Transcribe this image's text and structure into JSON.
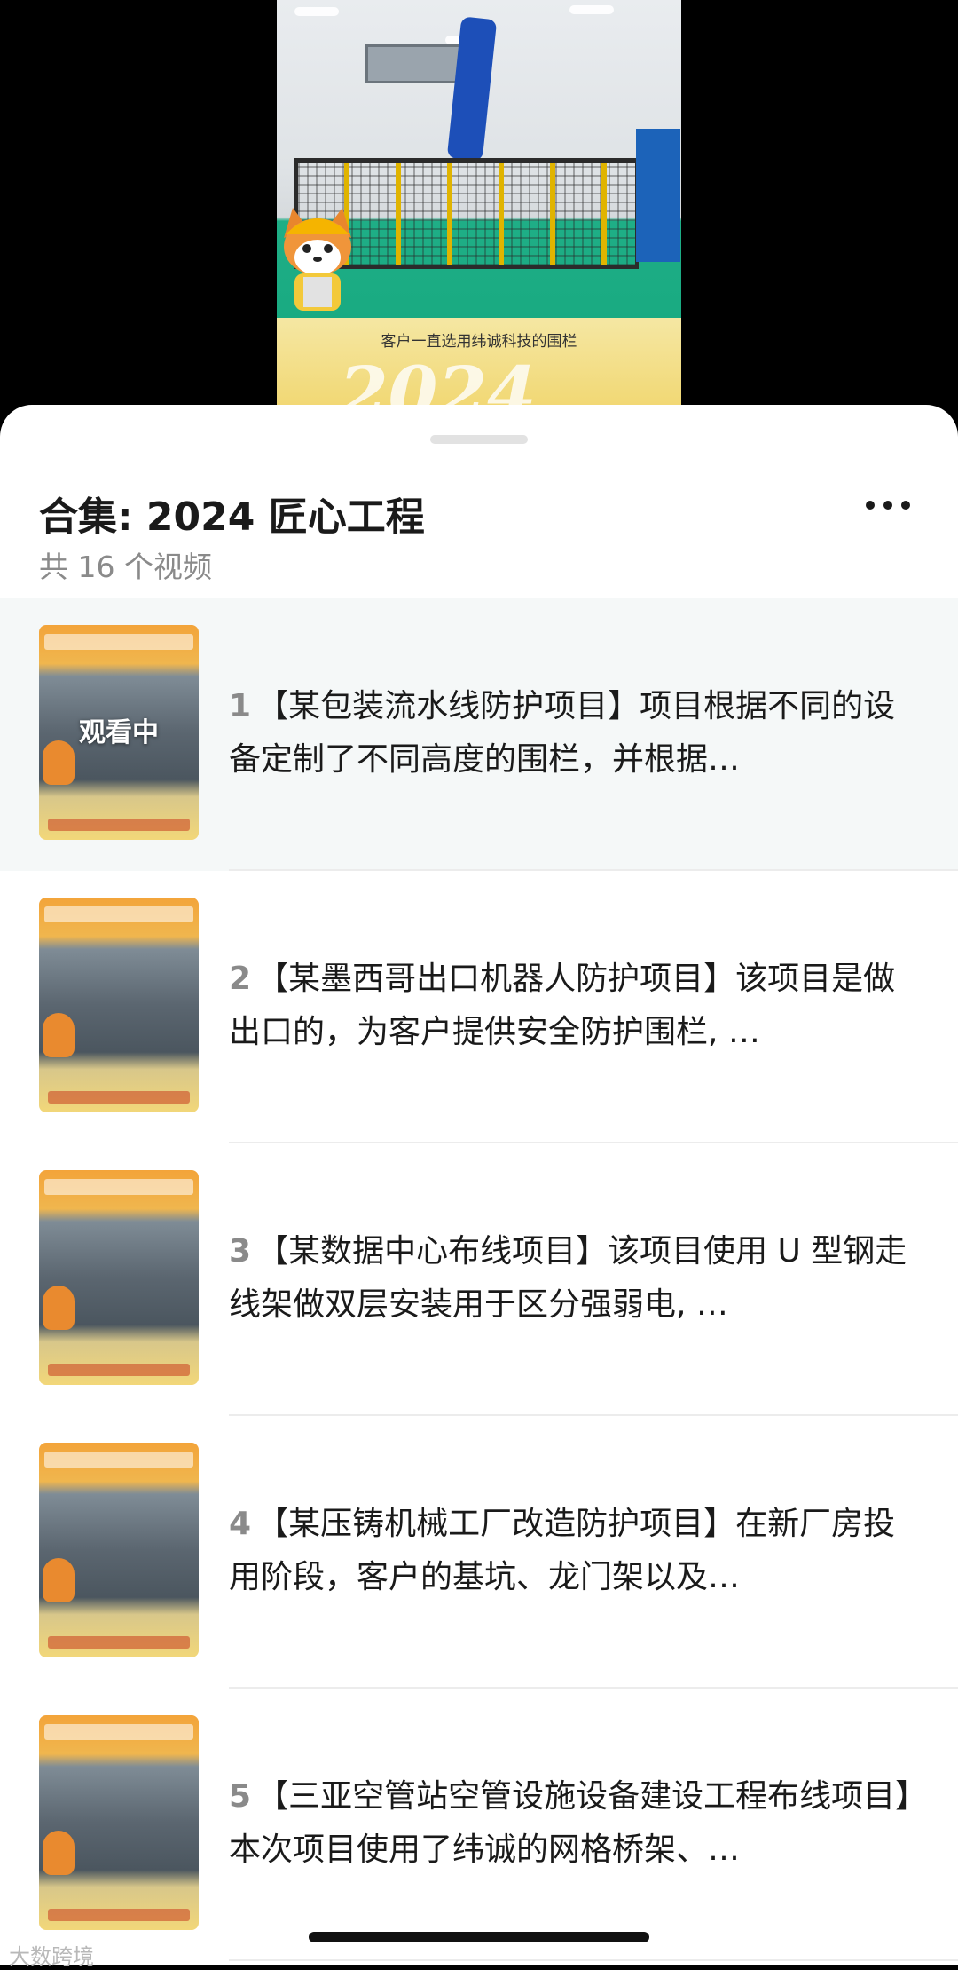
{
  "video": {
    "caption": "客户一直选用纬诚科技的围栏",
    "year_overlay": "2024"
  },
  "sheet": {
    "title": "合集: 2024 匠心工程",
    "count": "共 16 个视频"
  },
  "items": [
    {
      "num": "1",
      "text": "【某包装流水线防护项目】项目根据不同的设备定制了不同高度的围栏，并根据…",
      "watching_label": "观看中",
      "active": true
    },
    {
      "num": "2",
      "text": "【某墨西哥出口机器人防护项目】该项目是做出口的，为客户提供安全防护围栏, …",
      "active": false
    },
    {
      "num": "3",
      "text": "【某数据中心布线项目】该项目使用 U 型钢走线架做双层安装用于区分强弱电, …",
      "active": false
    },
    {
      "num": "4",
      "text": "【某压铸机械工厂改造防护项目】在新厂房投用阶段，客户的基坑、龙门架以及…",
      "active": false
    },
    {
      "num": "5",
      "text": "【三亚空管站空管设施设备建设工程布线项目】本次项目使用了纬诚的网格桥架、…",
      "active": false
    }
  ],
  "watermark": "大数跨境"
}
